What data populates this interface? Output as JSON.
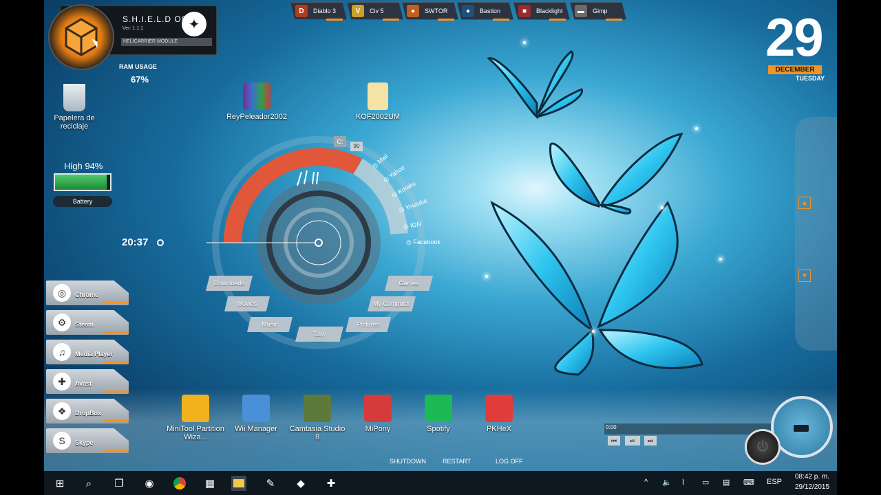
{
  "shield": {
    "title": "S.H.I.E.L.D OS",
    "version": "Ver: 1.1.1",
    "module": "HELICARRIER MODULE"
  },
  "ram": {
    "label": "RAM USAGE",
    "value": "67%"
  },
  "top_apps": [
    {
      "label": "Diablo 3",
      "icon": "D"
    },
    {
      "label": "Civ 5",
      "icon": "V"
    },
    {
      "label": "SWTOR",
      "icon": "●"
    },
    {
      "label": "Bastion",
      "icon": "●"
    },
    {
      "label": "Blacklight",
      "icon": "■"
    },
    {
      "label": "Gimp",
      "icon": "▬"
    }
  ],
  "date": {
    "day": "29",
    "month": "DECEMBER",
    "weekday": "TUESDAY"
  },
  "desktop_icons": {
    "recycle": "Papelera de reciclaje",
    "rey": "ReyPeleador2002",
    "kof": "KOF2002UM"
  },
  "battery": {
    "label": "High 94%",
    "name": "Battery",
    "level": 0.94
  },
  "circle_hud": {
    "time": "20:37",
    "drive": "C:",
    "drive_value": "90",
    "links": [
      "Mail",
      "Yahoo",
      "Kotaku",
      "Youtube",
      "IGN",
      "Facebook"
    ],
    "folders": [
      "Downloads",
      "Movies",
      "Music",
      "Tony",
      "Pictures",
      "My Computer",
      "Games"
    ]
  },
  "dock": [
    "Chrome",
    "Steam",
    "Media Player",
    "Avast",
    "DropBox",
    "Skype"
  ],
  "bottom_icons": [
    {
      "label": "MiniTool Partition Wiza...",
      "color": "#f2b21e"
    },
    {
      "label": "Wii Manager",
      "color": "#4a90d9"
    },
    {
      "label": "Camtasia Studio 8",
      "color": "#5c7a3a"
    },
    {
      "label": "MiPony",
      "color": "#d63b3b"
    },
    {
      "label": "Spotify",
      "color": "#1db954"
    },
    {
      "label": "PKHeX",
      "color": "#e23b3b"
    }
  ],
  "media": {
    "time": "0:00"
  },
  "power": {
    "shutdown": "SHUTDOWN",
    "restart": "RESTART",
    "logoff": "LOG OFF"
  },
  "taskbar": {
    "lang": "ESP",
    "time": "08:42 p. m.",
    "date": "29/12/2015"
  },
  "colors": {
    "accent": "#f39323",
    "hud_red": "#e0573a"
  }
}
